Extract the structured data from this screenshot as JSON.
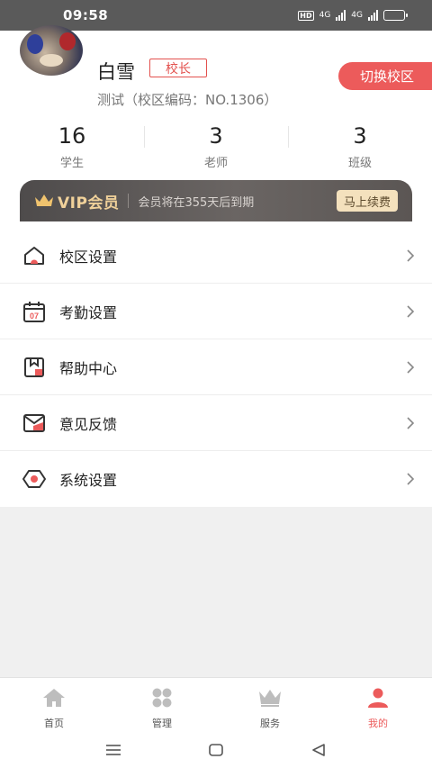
{
  "status_bar": {
    "time": "09:58",
    "hd_badge": "HD",
    "net1": "4G",
    "net2": "4G"
  },
  "profile": {
    "name": "白雪",
    "role": "校长",
    "campus_info": "测试（校区编码：NO.1306）",
    "switch_button": "切换校区"
  },
  "stats": [
    {
      "value": "16",
      "label": "学生"
    },
    {
      "value": "3",
      "label": "老师"
    },
    {
      "value": "3",
      "label": "班级"
    }
  ],
  "vip": {
    "title": "VIP会员",
    "expire_text": "会员将在355天后到期",
    "renew_button": "马上续费"
  },
  "menu": [
    {
      "label": "校区设置",
      "icon": "house-icon"
    },
    {
      "label": "考勤设置",
      "icon": "calendar-icon",
      "icon_text": "07"
    },
    {
      "label": "帮助中心",
      "icon": "help-icon"
    },
    {
      "label": "意见反馈",
      "icon": "envelope-icon"
    },
    {
      "label": "系统设置",
      "icon": "settings-icon"
    }
  ],
  "tabbar": [
    {
      "label": "首页",
      "icon": "home-icon",
      "active": false
    },
    {
      "label": "管理",
      "icon": "grid-icon",
      "active": false
    },
    {
      "label": "服务",
      "icon": "crown-icon",
      "active": false
    },
    {
      "label": "我的",
      "icon": "user-icon",
      "active": true
    }
  ],
  "colors": {
    "accent": "#ec5b5b",
    "vip_gold": "#f0d19a",
    "vip_bg": "#5b5654"
  }
}
